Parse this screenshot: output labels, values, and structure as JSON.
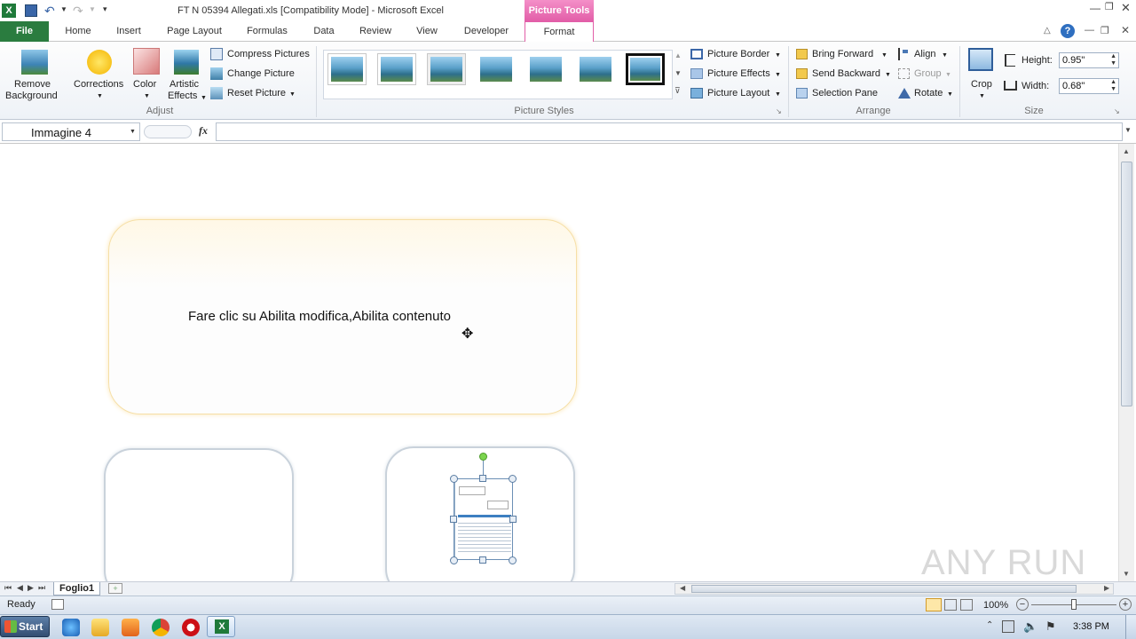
{
  "window": {
    "title": "FT N 05394 Allegati.xls  [Compatibility Mode] - Microsoft Excel",
    "context_tab": "Picture Tools"
  },
  "tabs": [
    "File",
    "Home",
    "Insert",
    "Page Layout",
    "Formulas",
    "Data",
    "Review",
    "View",
    "Developer",
    "Format"
  ],
  "ribbon": {
    "adjust": {
      "remove_bg_1": "Remove",
      "remove_bg_2": "Background",
      "corrections": "Corrections",
      "color": "Color",
      "artistic_1": "Artistic",
      "artistic_2": "Effects",
      "compress": "Compress Pictures",
      "change": "Change Picture",
      "reset": "Reset Picture",
      "label": "Adjust"
    },
    "styles": {
      "label": "Picture Styles",
      "border": "Picture Border",
      "effects": "Picture Effects",
      "layout": "Picture Layout"
    },
    "arrange": {
      "bring_forward": "Bring Forward",
      "send_backward": "Send Backward",
      "selection_pane": "Selection Pane",
      "align": "Align",
      "group": "Group",
      "rotate": "Rotate",
      "label": "Arrange"
    },
    "size": {
      "crop": "Crop",
      "height_label": "Height:",
      "height_value": "0.95\"",
      "width_label": "Width:",
      "width_value": "0.68\"",
      "label": "Size"
    }
  },
  "formula_bar": {
    "name_box": "Immagine 4",
    "fx": "fx",
    "value": ""
  },
  "sheet": {
    "message": "Fare clic su Abilita modifica,Abilita contenuto",
    "tab_name": "Foglio1"
  },
  "status": {
    "ready": "Ready",
    "zoom": "100%"
  },
  "taskbar": {
    "start": "Start",
    "time": "3:38 PM"
  },
  "watermark": "ANY RUN"
}
